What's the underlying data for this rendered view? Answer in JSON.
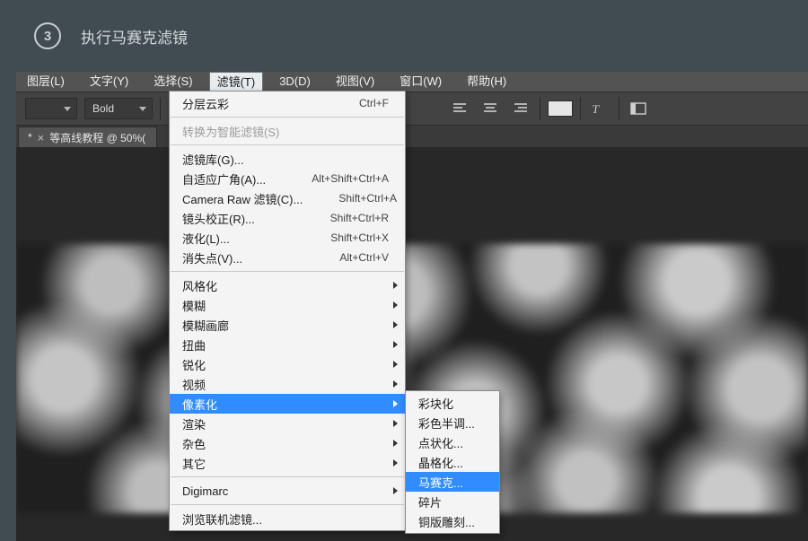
{
  "step": {
    "num": "3",
    "title": "执行马赛克滤镜"
  },
  "menubar": {
    "items": [
      {
        "label": "图层(L)"
      },
      {
        "label": "文字(Y)"
      },
      {
        "label": "选择(S)"
      },
      {
        "label": "滤镜(T)"
      },
      {
        "label": "3D(D)"
      },
      {
        "label": "视图(V)"
      },
      {
        "label": "窗口(W)"
      },
      {
        "label": "帮助(H)"
      }
    ],
    "active_index": 3
  },
  "optionsbar": {
    "font_weight": "Bold"
  },
  "document_tab": {
    "dirty": "*",
    "close": "×",
    "title": "等高线教程 @ 50%("
  },
  "filter_menu": {
    "last_filter": {
      "label": "分层云彩",
      "shortcut": "Ctrl+F"
    },
    "convert_smart": {
      "label": "转换为智能滤镜(S)"
    },
    "gallery": {
      "label": "滤镜库(G)..."
    },
    "adaptive_wide": {
      "label": "自适应广角(A)...",
      "shortcut": "Alt+Shift+Ctrl+A"
    },
    "camera_raw": {
      "label": "Camera Raw 滤镜(C)...",
      "shortcut": "Shift+Ctrl+A"
    },
    "lens_correct": {
      "label": "镜头校正(R)...",
      "shortcut": "Shift+Ctrl+R"
    },
    "liquify": {
      "label": "液化(L)...",
      "shortcut": "Shift+Ctrl+X"
    },
    "vanishing": {
      "label": "消失点(V)...",
      "shortcut": "Alt+Ctrl+V"
    },
    "stylize": {
      "label": "风格化"
    },
    "blur": {
      "label": "模糊"
    },
    "blur_gallery": {
      "label": "模糊画廊"
    },
    "distort": {
      "label": "扭曲"
    },
    "sharpen": {
      "label": "锐化"
    },
    "video": {
      "label": "视频"
    },
    "pixelate": {
      "label": "像素化"
    },
    "render": {
      "label": "渲染"
    },
    "noise": {
      "label": "杂色"
    },
    "other": {
      "label": "其它"
    },
    "digimarc": {
      "label": "Digimarc"
    },
    "browse_online": {
      "label": "浏览联机滤镜..."
    }
  },
  "pixelate_submenu": {
    "color_halftone": "彩块化",
    "color_halftone2": "彩色半调...",
    "pointillize": "点状化...",
    "crystallize": "晶格化...",
    "mosaic": "马赛克...",
    "fragment": "碎片",
    "mezzotint": "铜版雕刻..."
  }
}
